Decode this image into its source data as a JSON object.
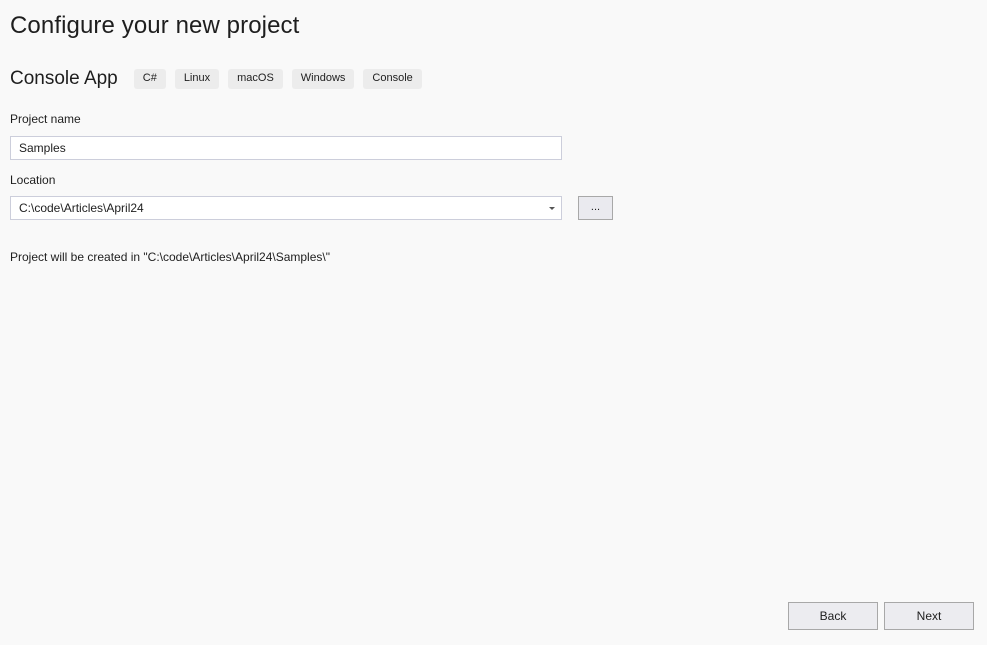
{
  "header": {
    "title": "Configure your new project"
  },
  "template": {
    "name": "Console App",
    "tags": [
      "C#",
      "Linux",
      "macOS",
      "Windows",
      "Console"
    ]
  },
  "form": {
    "project_name": {
      "label": "Project name",
      "value": "Samples"
    },
    "location": {
      "label": "Location",
      "value": "C:\\code\\Articles\\April24",
      "dropdown_icon": "chevron-down-icon",
      "browse_label": "..."
    },
    "create_path_message": "Project will be created in \"C:\\code\\Articles\\April24\\Samples\\\""
  },
  "footer": {
    "back_label": "Back",
    "next_label": "Next"
  }
}
